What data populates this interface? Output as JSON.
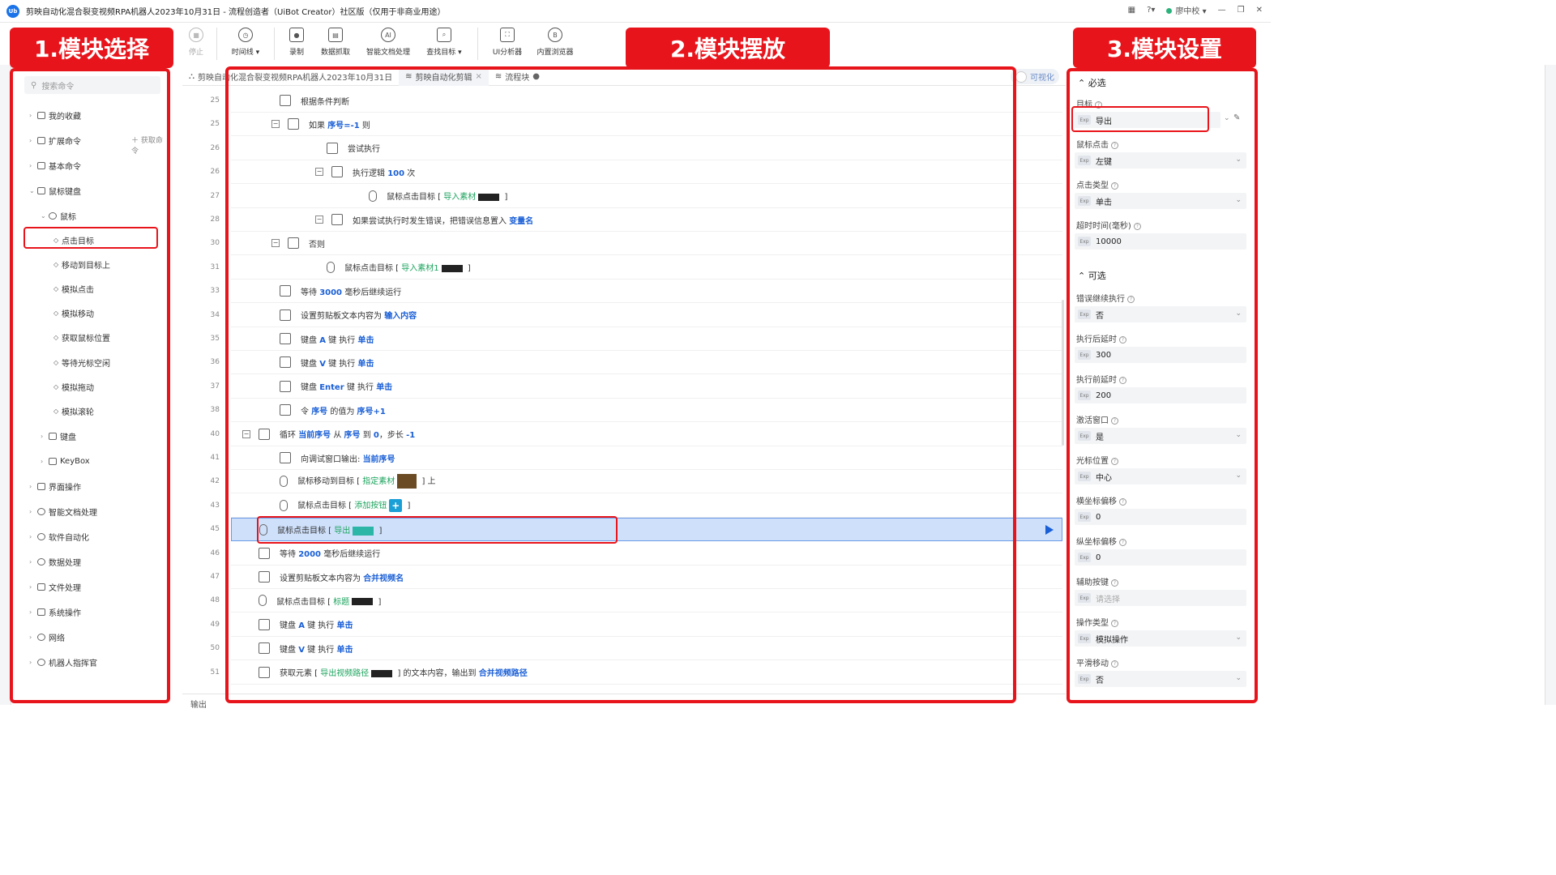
{
  "window": {
    "title": "剪映自动化混合裂变视频RPA机器人2023年10月31日 - 流程创造者（UiBot Creator）社区版（仅用于非商业用途）",
    "user": "廖中校"
  },
  "toolbar": {
    "stop": "停止",
    "timeline": "时间线",
    "record": "录制",
    "data_scrape": "数据抓取",
    "smart_doc": "智能文档处理",
    "find_target": "查找目标",
    "ui_analyzer": "UI分析器",
    "browser": "内置浏览器"
  },
  "banners": {
    "left": "1.模块选择",
    "middle": "2.模块摆放",
    "right": "3.模块设置"
  },
  "left_panel": {
    "search_placeholder": "搜索命令",
    "get_command": "获取命令",
    "items": [
      {
        "label": "我的收藏"
      },
      {
        "label": "扩展命令"
      },
      {
        "label": "基本命令"
      },
      {
        "label": "鼠标键盘"
      },
      {
        "label": "鼠标"
      },
      {
        "label": "点击目标"
      },
      {
        "label": "移动到目标上"
      },
      {
        "label": "模拟点击"
      },
      {
        "label": "模拟移动"
      },
      {
        "label": "获取鼠标位置"
      },
      {
        "label": "等待光标空闲"
      },
      {
        "label": "模拟拖动"
      },
      {
        "label": "模拟滚轮"
      },
      {
        "label": "键盘"
      },
      {
        "label": "KeyBox"
      },
      {
        "label": "界面操作"
      },
      {
        "label": "智能文档处理"
      },
      {
        "label": "软件自动化"
      },
      {
        "label": "数据处理"
      },
      {
        "label": "文件处理"
      },
      {
        "label": "系统操作"
      },
      {
        "label": "网络"
      },
      {
        "label": "机器人指挥官"
      }
    ]
  },
  "tabs": [
    {
      "label": "剪映自动化混合裂变视频RPA机器人2023年10月31日"
    },
    {
      "label": "剪映自动化剪辑"
    },
    {
      "label": "流程块"
    }
  ],
  "visualize_label": "可视化",
  "flow": {
    "rows": [
      {
        "line": "25",
        "parts": [
          {
            "t": "根据条件判断",
            "c": ""
          }
        ]
      },
      {
        "line": "25",
        "parts": [
          {
            "t": "如果 ",
            "c": ""
          },
          {
            "t": "序号=-1",
            "c": "kw"
          },
          {
            "t": " 则",
            "c": ""
          }
        ]
      },
      {
        "line": "26",
        "parts": [
          {
            "t": "尝试执行",
            "c": ""
          }
        ]
      },
      {
        "line": "26",
        "parts": [
          {
            "t": "执行逻辑 ",
            "c": ""
          },
          {
            "t": "100",
            "c": "kw"
          },
          {
            "t": " 次",
            "c": ""
          }
        ]
      },
      {
        "line": "27",
        "parts": [
          {
            "t": "鼠标点击目标 [ ",
            "c": ""
          },
          {
            "t": "导入素材",
            "c": "kwg"
          },
          {
            "t": " ]",
            "c": ""
          }
        ]
      },
      {
        "line": "28",
        "parts": [
          {
            "t": "如果尝试执行时发生错误，把错误信息置入 ",
            "c": ""
          },
          {
            "t": "变量名",
            "c": "kw"
          }
        ]
      },
      {
        "line": "30",
        "parts": [
          {
            "t": "否则",
            "c": ""
          }
        ]
      },
      {
        "line": "31",
        "parts": [
          {
            "t": "鼠标点击目标 [ ",
            "c": ""
          },
          {
            "t": "导入素材1",
            "c": "kwg"
          },
          {
            "t": " ]",
            "c": ""
          }
        ]
      },
      {
        "line": "33",
        "parts": [
          {
            "t": "等待 ",
            "c": ""
          },
          {
            "t": "3000",
            "c": "kw"
          },
          {
            "t": " 毫秒后继续运行",
            "c": ""
          }
        ]
      },
      {
        "line": "34",
        "parts": [
          {
            "t": "设置剪贴板文本内容为 ",
            "c": ""
          },
          {
            "t": "输入内容",
            "c": "kw"
          }
        ]
      },
      {
        "line": "35",
        "parts": [
          {
            "t": "键盘 ",
            "c": ""
          },
          {
            "t": "A",
            "c": "kw"
          },
          {
            "t": " 键 执行 ",
            "c": ""
          },
          {
            "t": "单击",
            "c": "kw"
          }
        ]
      },
      {
        "line": "36",
        "parts": [
          {
            "t": "键盘 ",
            "c": ""
          },
          {
            "t": "V",
            "c": "kw"
          },
          {
            "t": " 键 执行 ",
            "c": ""
          },
          {
            "t": "单击",
            "c": "kw"
          }
        ]
      },
      {
        "line": "37",
        "parts": [
          {
            "t": "键盘 ",
            "c": ""
          },
          {
            "t": "Enter",
            "c": "kw"
          },
          {
            "t": " 键 执行 ",
            "c": ""
          },
          {
            "t": "单击",
            "c": "kw"
          }
        ]
      },
      {
        "line": "38",
        "parts": [
          {
            "t": "令 ",
            "c": ""
          },
          {
            "t": "序号",
            "c": "kw"
          },
          {
            "t": " 的值为 ",
            "c": ""
          },
          {
            "t": "序号+1",
            "c": "kw"
          }
        ]
      },
      {
        "line": "40",
        "parts": [
          {
            "t": "循环 ",
            "c": ""
          },
          {
            "t": "当前序号",
            "c": "kw"
          },
          {
            "t": " 从 ",
            "c": ""
          },
          {
            "t": "序号",
            "c": "kw"
          },
          {
            "t": " 到 ",
            "c": ""
          },
          {
            "t": "0",
            "c": "kw"
          },
          {
            "t": "，步长 ",
            "c": ""
          },
          {
            "t": "-1",
            "c": "kw"
          }
        ]
      },
      {
        "line": "41",
        "parts": [
          {
            "t": "向调试窗口输出: ",
            "c": ""
          },
          {
            "t": "当前序号",
            "c": "kw"
          }
        ]
      },
      {
        "line": "42",
        "parts": [
          {
            "t": "鼠标移动到目标 [ ",
            "c": ""
          },
          {
            "t": "指定素材",
            "c": "kwg"
          },
          {
            "t": " ] 上",
            "c": ""
          }
        ]
      },
      {
        "line": "43",
        "parts": [
          {
            "t": "鼠标点击目标 [ ",
            "c": ""
          },
          {
            "t": "添加按钮",
            "c": "kwg"
          },
          {
            "t": " ]",
            "c": ""
          }
        ]
      },
      {
        "line": "45",
        "parts": [
          {
            "t": "鼠标点击目标 [ ",
            "c": ""
          },
          {
            "t": "导出",
            "c": "kwg"
          },
          {
            "t": " ]",
            "c": ""
          }
        ]
      },
      {
        "line": "46",
        "parts": [
          {
            "t": "等待 ",
            "c": ""
          },
          {
            "t": "2000",
            "c": "kw"
          },
          {
            "t": " 毫秒后继续运行",
            "c": ""
          }
        ]
      },
      {
        "line": "47",
        "parts": [
          {
            "t": "设置剪贴板文本内容为 ",
            "c": ""
          },
          {
            "t": "合并视频名",
            "c": "kw"
          }
        ]
      },
      {
        "line": "48",
        "parts": [
          {
            "t": "鼠标点击目标 [ ",
            "c": ""
          },
          {
            "t": "标题",
            "c": "kwg"
          },
          {
            "t": " ]",
            "c": ""
          }
        ]
      },
      {
        "line": "49",
        "parts": [
          {
            "t": "键盘 ",
            "c": ""
          },
          {
            "t": "A",
            "c": "kw"
          },
          {
            "t": " 键 执行 ",
            "c": ""
          },
          {
            "t": "单击",
            "c": "kw"
          }
        ]
      },
      {
        "line": "50",
        "parts": [
          {
            "t": "键盘 ",
            "c": ""
          },
          {
            "t": "V",
            "c": "kw"
          },
          {
            "t": " 键 执行 ",
            "c": ""
          },
          {
            "t": "单击",
            "c": "kw"
          }
        ]
      },
      {
        "line": "51",
        "parts": [
          {
            "t": "获取元素 [ ",
            "c": ""
          },
          {
            "t": "导出视频路径",
            "c": "kwg"
          },
          {
            "t": " ] 的文本内容，输出到 ",
            "c": ""
          },
          {
            "t": "合并视频路径",
            "c": "kw"
          }
        ]
      }
    ]
  },
  "right_panel": {
    "required": "必选",
    "optional": "可选",
    "exp": "Exp",
    "fields": [
      {
        "label": "目标",
        "value": "导出"
      },
      {
        "label": "鼠标点击",
        "value": "左键"
      },
      {
        "label": "点击类型",
        "value": "单击"
      },
      {
        "label": "超时时间(毫秒)",
        "value": "10000"
      },
      {
        "label": "错误继续执行",
        "value": "否"
      },
      {
        "label": "执行后延时",
        "value": "300"
      },
      {
        "label": "执行前延时",
        "value": "200"
      },
      {
        "label": "激活窗口",
        "value": "是"
      },
      {
        "label": "光标位置",
        "value": "中心"
      },
      {
        "label": "横坐标偏移",
        "value": "0"
      },
      {
        "label": "纵坐标偏移",
        "value": "0"
      },
      {
        "label": "辅助按键",
        "value": "",
        "placeholder": "请选择"
      },
      {
        "label": "操作类型",
        "value": "模拟操作"
      },
      {
        "label": "平滑移动",
        "value": "否"
      }
    ]
  },
  "bottom": {
    "output": "输出"
  }
}
